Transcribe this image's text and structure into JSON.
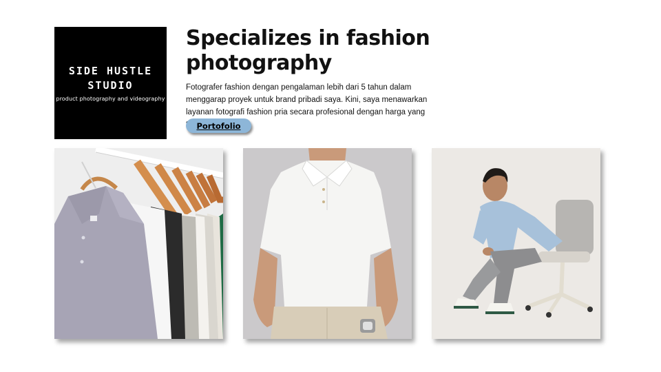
{
  "brand": {
    "line1": "SIDE HUSTLE",
    "line2": "STUDIO",
    "tagline": "product photography and videography"
  },
  "headline": "Specializes in fashion photography",
  "description": "Fotografer fashion dengan pengalaman lebih dari 5 tahun dalam menggarap proyek untuk brand pribadi saya. Kini, saya menawarkan layanan fotografi fashion pria secara profesional dengan harga  yang terjangkau.",
  "portfolio_button": "Portofolio",
  "colors": {
    "brand_box": "#000000",
    "button": "#8db6d8",
    "background": "#ffffff"
  },
  "gallery": [
    {
      "icon": "shirts-on-hangers-photo"
    },
    {
      "icon": "white-polo-shirt-photo"
    },
    {
      "icon": "seated-model-photo"
    }
  ]
}
